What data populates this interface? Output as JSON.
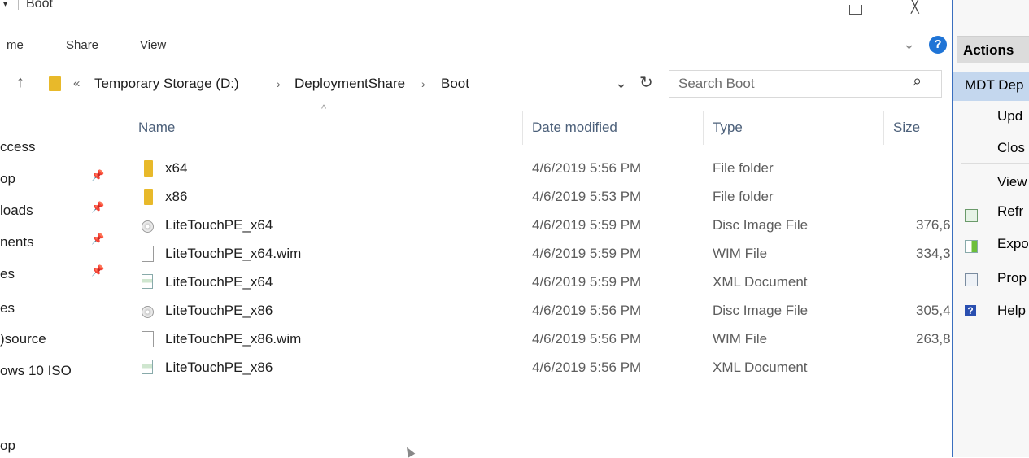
{
  "window": {
    "title": "Boot",
    "qa_chevron": "▾",
    "restore_glyph": "",
    "close_glyph": "╳"
  },
  "ribbon": {
    "tabs": [
      "me",
      "Share",
      "View"
    ]
  },
  "address": {
    "up_glyph": "↑",
    "overflow": "«",
    "crumbs": [
      "Temporary Storage (D:)",
      "DeploymentShare",
      "Boot"
    ],
    "sep_glyph": "›",
    "dropdown_glyph": "⌄",
    "refresh_glyph": "↻"
  },
  "search": {
    "placeholder": "Search Boot",
    "icon_glyph": "⌕"
  },
  "help_glyph": "?",
  "ribbon_chevron": "⌄",
  "columns": {
    "name": "Name",
    "date": "Date modified",
    "type": "Type",
    "size": "Size",
    "sort_glyph": "^"
  },
  "nav": [
    {
      "label": "ccess",
      "pinned": false
    },
    {
      "label": "op",
      "pinned": true
    },
    {
      "label": "loads",
      "pinned": true
    },
    {
      "label": "nents",
      "pinned": true
    },
    {
      "label": "es",
      "pinned": true
    },
    {
      "label": "es",
      "pinned": false
    },
    {
      "label": ")source",
      "pinned": false
    },
    {
      "label": "ows 10 ISO",
      "pinned": false
    },
    {
      "label": "op",
      "pinned": false
    }
  ],
  "pin_glyph": "📌",
  "files": [
    {
      "name": "x64",
      "date": "4/6/2019 5:56 PM",
      "type": "File folder",
      "size": "",
      "icon": "folder-icon"
    },
    {
      "name": "x86",
      "date": "4/6/2019 5:53 PM",
      "type": "File folder",
      "size": "",
      "icon": "folder-icon"
    },
    {
      "name": "LiteTouchPE_x64",
      "date": "4/6/2019 5:59 PM",
      "type": "Disc Image File",
      "size": "376,6",
      "icon": "disc-image-icon"
    },
    {
      "name": "LiteTouchPE_x64.wim",
      "date": "4/6/2019 5:59 PM",
      "type": "WIM File",
      "size": "334,3",
      "icon": "file-icon"
    },
    {
      "name": "LiteTouchPE_x64",
      "date": "4/6/2019 5:59 PM",
      "type": "XML Document",
      "size": "",
      "icon": "xml-icon"
    },
    {
      "name": "LiteTouchPE_x86",
      "date": "4/6/2019 5:56 PM",
      "type": "Disc Image File",
      "size": "305,4",
      "icon": "disc-image-icon"
    },
    {
      "name": "LiteTouchPE_x86.wim",
      "date": "4/6/2019 5:56 PM",
      "type": "WIM File",
      "size": "263,8",
      "icon": "file-icon"
    },
    {
      "name": "LiteTouchPE_x86",
      "date": "4/6/2019 5:56 PM",
      "type": "XML Document",
      "size": "",
      "icon": "xml-icon"
    }
  ],
  "mmc": {
    "actions_header": "Actions",
    "selected": "MDT Dep",
    "items": [
      "Upd",
      "Clos",
      "View",
      "Refr",
      "Expo",
      "Prop",
      "Help"
    ]
  }
}
